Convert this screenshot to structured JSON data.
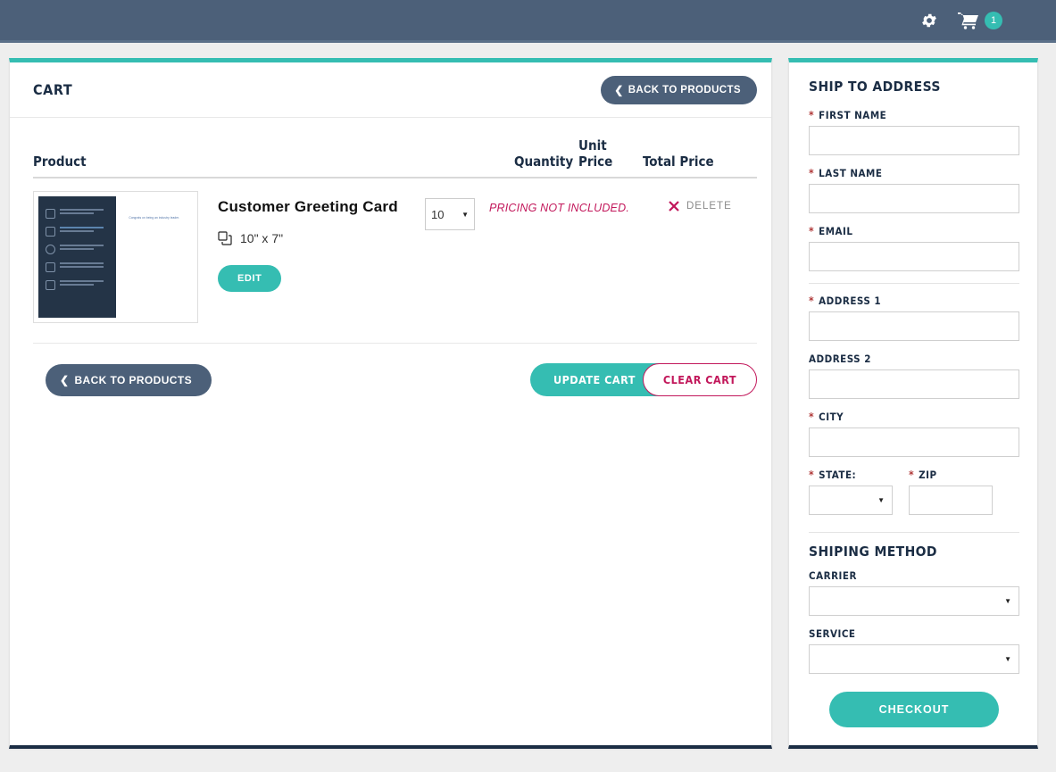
{
  "navbar": {
    "gear_icon": "gear-icon",
    "cart_icon": "cart-icon",
    "cart_count": "1",
    "background_color": "#4c6079"
  },
  "theme": {
    "accent_teal": "#35bdb2",
    "dark_slate": "#4c6079",
    "navy": "#1b2d44",
    "crimson": "#c2185b"
  },
  "cart": {
    "title": "CART",
    "back_to_products_top": "BACK TO PRODUCTS",
    "back_to_products_bottom": "BACK TO PRODUCTS",
    "update_cart": "UPDATE CART",
    "clear_cart": "CLEAR CART",
    "columns": {
      "product": "Product",
      "quantity": "Quantity",
      "unit_price": "Unit Price",
      "total_price": "Total Price"
    },
    "items": [
      {
        "name": "Customer Greeting Card",
        "dimensions": "10\" x 7\"",
        "dimensions_icon": "copy-pages-icon",
        "edit_label": "EDIT",
        "quantity": "10",
        "price_note": "PRICING NOT INCLUDED.",
        "delete_label": "DELETE",
        "delete_icon": "x-mark-icon",
        "thumbnail": {
          "tagline": "Congrats on being an industry leader."
        }
      }
    ]
  },
  "ship_to": {
    "title": "SHIP TO ADDRESS",
    "fields": [
      {
        "label": "FIRST NAME",
        "required": true,
        "type": "text",
        "value": ""
      },
      {
        "label": "LAST NAME",
        "required": true,
        "type": "text",
        "value": ""
      },
      {
        "label": "EMAIL",
        "required": true,
        "type": "text",
        "value": ""
      },
      {
        "label": "ADDRESS 1",
        "required": true,
        "type": "text",
        "value": ""
      },
      {
        "label": "ADDRESS 2",
        "required": false,
        "type": "text",
        "value": ""
      },
      {
        "label": "CITY",
        "required": true,
        "type": "text",
        "value": ""
      },
      {
        "label": "STATE:",
        "required": true,
        "type": "select",
        "value": ""
      },
      {
        "label": "ZIP",
        "required": true,
        "type": "text",
        "value": ""
      }
    ],
    "required_marker": "*"
  },
  "shipping_method": {
    "title": "SHIPING METHOD",
    "carrier_label": "CARRIER",
    "carrier_value": "",
    "service_label": "SERVICE",
    "service_value": "",
    "checkout_label": "CHECKOUT"
  }
}
